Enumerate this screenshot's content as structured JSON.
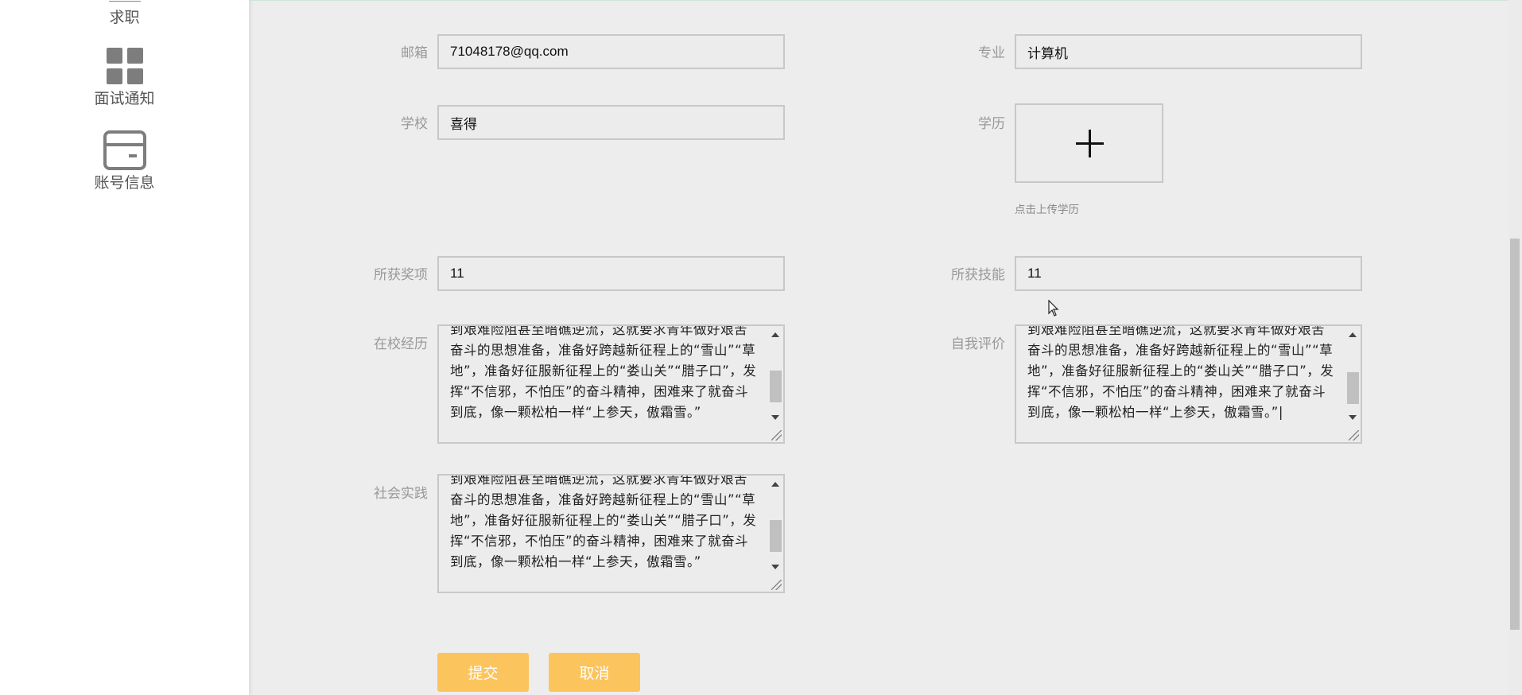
{
  "sidebar": {
    "items": [
      {
        "label": "求职",
        "icon": "briefcase-icon"
      },
      {
        "label": "面试通知",
        "icon": "grid-icon"
      },
      {
        "label": "账号信息",
        "icon": "card-icon"
      }
    ]
  },
  "form": {
    "email": {
      "label": "邮箱",
      "value": "71048178@qq.com"
    },
    "major": {
      "label": "专业",
      "value": "计算机"
    },
    "school": {
      "label": "学校",
      "value": "喜得"
    },
    "education": {
      "label": "学历",
      "upload_hint": "点击上传学历"
    },
    "awards": {
      "label": "所获奖项",
      "value": "11"
    },
    "skills": {
      "label": "所获技能",
      "value": "11"
    },
    "campus_experience": {
      "label": "在校经历",
      "text": "到艰难险阻甚至暗礁逆流，这就要求青年做好艰苦奋斗的思想准备，准备好跨越新征程上的“雪山”“草地”，准备好征服新征程上的“娄山关”“腊子口”，发挥“不信邪，不怕压”的奋斗精神，困难来了就奋斗到底，像一颗松柏一样“上参天，傲霜雪。”"
    },
    "self_evaluation": {
      "label": "自我评价",
      "text": "到艰难险阻甚至暗礁逆流，这就要求青年做好艰苦奋斗的思想准备，准备好跨越新征程上的“雪山”“草地”，准备好征服新征程上的“娄山关”“腊子口”，发挥“不信邪，不怕压”的奋斗精神，困难来了就奋斗到底，像一颗松柏一样“上参天，傲霜雪。”|"
    },
    "social_practice": {
      "label": "社会实践",
      "text": "到艰难险阻甚至暗礁逆流，这就要求青年做好艰苦奋斗的思想准备，准备好跨越新征程上的“雪山”“草地”，准备好征服新征程上的“娄山关”“腊子口”，发挥“不信邪，不怕压”的奋斗精神，困难来了就奋斗到底，像一颗松柏一样“上参天，傲霜雪。”"
    }
  },
  "buttons": {
    "submit": "提交",
    "cancel": "取消"
  },
  "colors": {
    "button": "#fcc45c",
    "background": "#ededed",
    "sidebar": "#ffffff"
  }
}
